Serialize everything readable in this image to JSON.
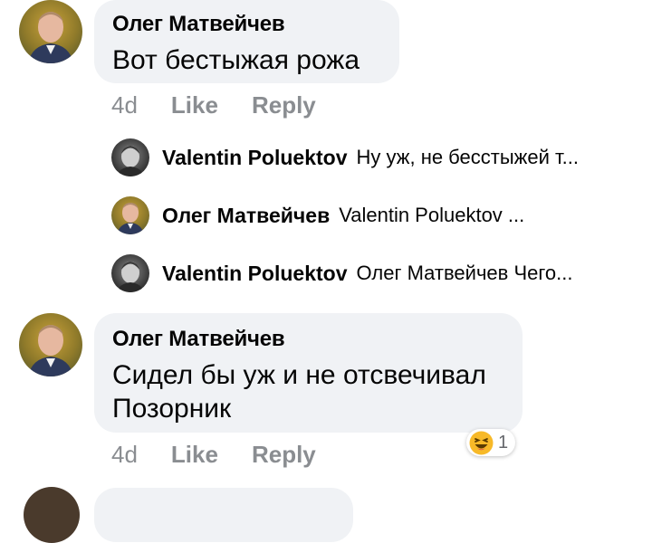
{
  "comments": [
    {
      "author": "Олег Матвейчев",
      "text_lines": [
        "Вот бестыжая рожа"
      ],
      "time": "4d",
      "like_label": "Like",
      "reply_label": "Reply"
    },
    {
      "author": "Олег Матвейчев",
      "text_lines": [
        "Сидел бы уж и не отсвечивал",
        "Позорник"
      ],
      "time": "4d",
      "like_label": "Like",
      "reply_label": "Reply",
      "reaction": {
        "icon": "haha-emoji-icon",
        "count": "1"
      }
    }
  ],
  "replies": [
    {
      "author": "Valentin Poluektov",
      "snippet": "Ну уж, не бесстыжей т..."
    },
    {
      "author": "Олег Матвейчев",
      "snippet": "Valentin Poluektov ..."
    },
    {
      "author": "Valentin Poluektov",
      "snippet": "Олег Матвейчев  Чего..."
    }
  ],
  "colors": {
    "bubble": "#f0f2f5",
    "text": "#050505",
    "meta": "#8a8d91",
    "reaction_yellow": "#f7b928"
  }
}
